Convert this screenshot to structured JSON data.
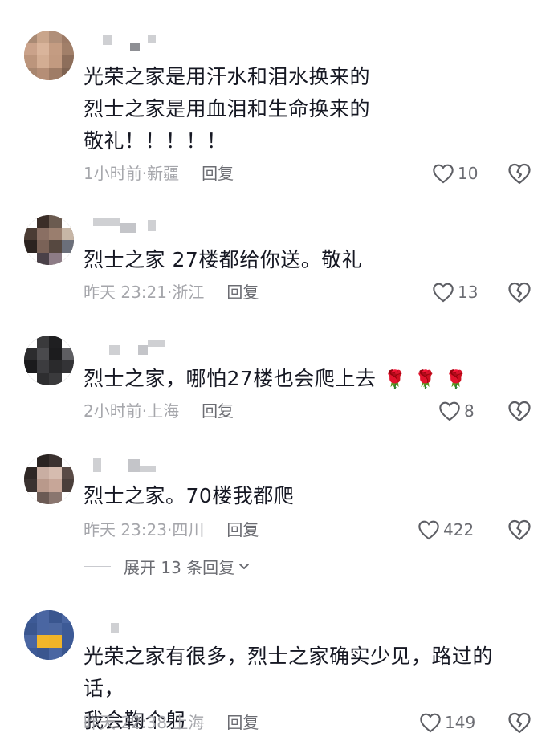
{
  "comments": [
    {
      "text": "光荣之家是用汗水和泪水换来的\n烈士之家是用血泪和生命换来的\n敬礼！！！！！",
      "time": "1小时前",
      "location": "新疆",
      "reply": "回复",
      "likes": "10"
    },
    {
      "text": "烈士之家 27楼都给你送。敬礼",
      "time": "昨天 23:21",
      "location": "浙江",
      "reply": "回复",
      "likes": "13"
    },
    {
      "text": "烈士之家，哪怕27楼也会爬上去",
      "time": "2小时前",
      "location": "上海",
      "reply": "回复",
      "likes": "8",
      "emoji": "🌹"
    },
    {
      "text": "烈士之家。70楼我都爬",
      "time": "昨天 23:23",
      "location": "四川",
      "reply": "回复",
      "likes": "422"
    },
    {
      "text": "光荣之家有很多，烈士之家确实少见，路过的话，\n我会鞠个躬",
      "time": "昨天 22:38",
      "location": "上海",
      "reply": "回复",
      "likes": "149"
    }
  ],
  "expand_replies": "展开 13 条回复",
  "meta_separator": "·",
  "icons": {
    "like": "heart-outline-icon",
    "dislike": "broken-heart-icon",
    "expand": "chevron-down-icon"
  },
  "colors": {
    "text": "#161823",
    "meta": "#a5a6ab",
    "secondary": "#6b6c72"
  }
}
